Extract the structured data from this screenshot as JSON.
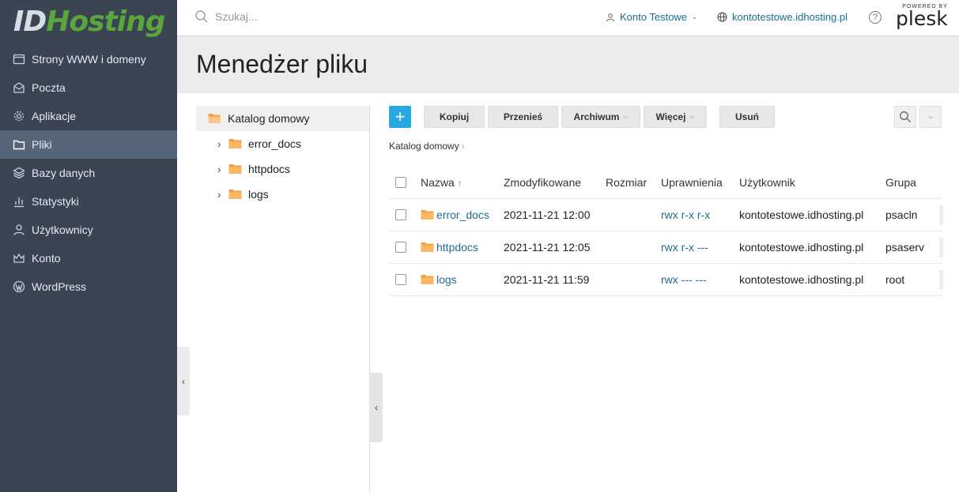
{
  "logo": {
    "part1": "ID",
    "part2": "Hosting"
  },
  "sidebar": {
    "items": [
      {
        "label": "Strony WWW i domeny",
        "icon": "globe-icon"
      },
      {
        "label": "Poczta",
        "icon": "mail-icon"
      },
      {
        "label": "Aplikacje",
        "icon": "gear-icon"
      },
      {
        "label": "Pliki",
        "icon": "folder-icon",
        "active": true
      },
      {
        "label": "Bazy danych",
        "icon": "database-icon"
      },
      {
        "label": "Statystyki",
        "icon": "bar-chart-icon"
      },
      {
        "label": "Użytkownicy",
        "icon": "user-icon"
      },
      {
        "label": "Konto",
        "icon": "account-icon"
      },
      {
        "label": "WordPress",
        "icon": "wordpress-icon"
      }
    ]
  },
  "header": {
    "search_placeholder": "Szukaj...",
    "account": "Konto Testowe",
    "domain": "kontotestowe.idhosting.pl",
    "help": "?",
    "powered_by": "POWERED BY",
    "plesk": "plesk"
  },
  "page": {
    "title": "Menedżer pliku"
  },
  "tree": {
    "root": "Katalog domowy",
    "items": [
      "error_docs",
      "httpdocs",
      "logs"
    ]
  },
  "toolbar": {
    "add": "+",
    "copy": "Kopiuj",
    "move": "Przenieś",
    "archive": "Archiwum",
    "more": "Więcej",
    "delete": "Usuń"
  },
  "breadcrumb": {
    "current": "Katalog domowy"
  },
  "table": {
    "columns": {
      "name": "Nazwa",
      "modified": "Zmodyfikowane",
      "size": "Rozmiar",
      "permissions": "Uprawnienia",
      "user": "Użytkownik",
      "group": "Grupa"
    },
    "rows": [
      {
        "name": "error_docs",
        "modified": "2021-11-21 12:00",
        "size": "",
        "permissions": "rwx r-x r-x",
        "user": "kontotestowe.idhosting.pl",
        "group": "psacln"
      },
      {
        "name": "httpdocs",
        "modified": "2021-11-21 12:05",
        "size": "",
        "permissions": "rwx r-x ---",
        "user": "kontotestowe.idhosting.pl",
        "group": "psaserv"
      },
      {
        "name": "logs",
        "modified": "2021-11-21 11:59",
        "size": "",
        "permissions": "rwx --- ---",
        "user": "kontotestowe.idhosting.pl",
        "group": "root"
      }
    ]
  },
  "colors": {
    "sidebar": "#3a4453",
    "sidebar_active": "#566578",
    "accent": "#28a7e0",
    "link": "#1c6c94",
    "folder": "#f5a04a",
    "logo_green": "#5aa63c"
  }
}
